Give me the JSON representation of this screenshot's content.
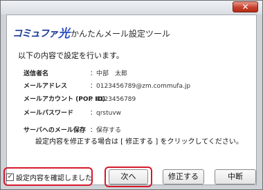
{
  "window": {
    "close_glyph": "✕"
  },
  "logo": {
    "brand": "コミュファ",
    "hikari": "光"
  },
  "tool_title": "かんたんメール設定ツール",
  "intro": "以下の内容で設定を行います。",
  "fields": [
    {
      "label": "送信者名",
      "value": "：中部　太郎"
    },
    {
      "label": "メールアドレス",
      "value": "：0123456789@zm.commufa.jp"
    },
    {
      "label": "メールアカウント (POP ID)",
      "value": "：0123456789"
    },
    {
      "label": "メールパスワード",
      "value": "：qrstuvw"
    },
    {
      "label": "サーバへのメール保存",
      "value": "：保存する"
    }
  ],
  "note": "設定内容を修正する場合は [ 修正する ] をクリックしてください。",
  "confirm_checkbox": {
    "label": "設定内容を確認しました",
    "checked": true,
    "check_glyph": "✓"
  },
  "buttons": {
    "next": "次へ",
    "modify": "修正する",
    "cancel": "中断"
  },
  "colors": {
    "highlight": "#d6182a",
    "logo": "#1a3a96",
    "close": "#c7402c"
  }
}
